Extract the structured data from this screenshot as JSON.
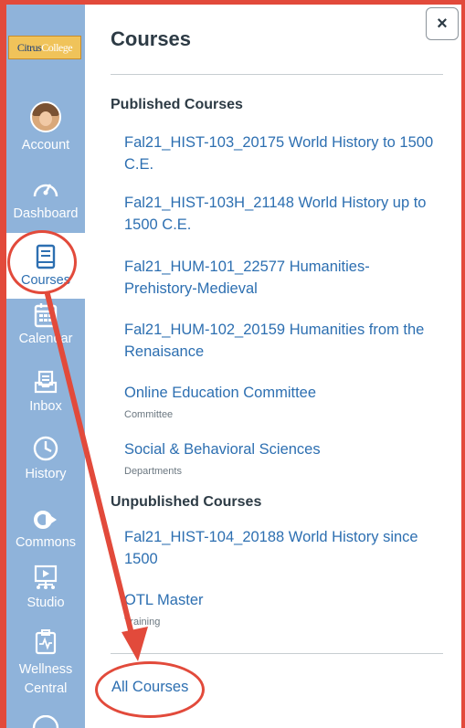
{
  "logo": {
    "part1": "Citrus",
    "part2": "College"
  },
  "nav": {
    "account": "Account",
    "dashboard": "Dashboard",
    "courses": "Courses",
    "calendar": "Calendar",
    "inbox": "Inbox",
    "history": "History",
    "commons": "Commons",
    "studio": "Studio",
    "wellness": "Wellness Central"
  },
  "tray": {
    "title": "Courses",
    "close_label": "×",
    "published_heading": "Published Courses",
    "published": [
      {
        "name": "Fal21_HIST-103_20175 World History to 1500 C.E.",
        "sub": ""
      },
      {
        "name": "Fal21_HIST-103H_21148 World History up to 1500 C.E.",
        "sub": ""
      },
      {
        "name": "Fal21_HUM-101_22577 Humanities-Prehistory-Medieval",
        "sub": ""
      },
      {
        "name": "Fal21_HUM-102_20159 Humanities from the Renaisance",
        "sub": ""
      },
      {
        "name": "Online Education Committee",
        "sub": "Committee"
      },
      {
        "name": "Social & Behavioral Sciences",
        "sub": "Departments"
      }
    ],
    "unpublished_heading": "Unpublished Courses",
    "unpublished": [
      {
        "name": "Fal21_HIST-104_20188 World History since 1500",
        "sub": ""
      },
      {
        "name": "OTL Master",
        "sub": "Training"
      }
    ],
    "all_courses": "All Courses"
  },
  "colors": {
    "nav_bg": "#8fb3da",
    "link": "#2d6fb1",
    "annotation": "#e24a3b",
    "text": "#2d3b45"
  }
}
